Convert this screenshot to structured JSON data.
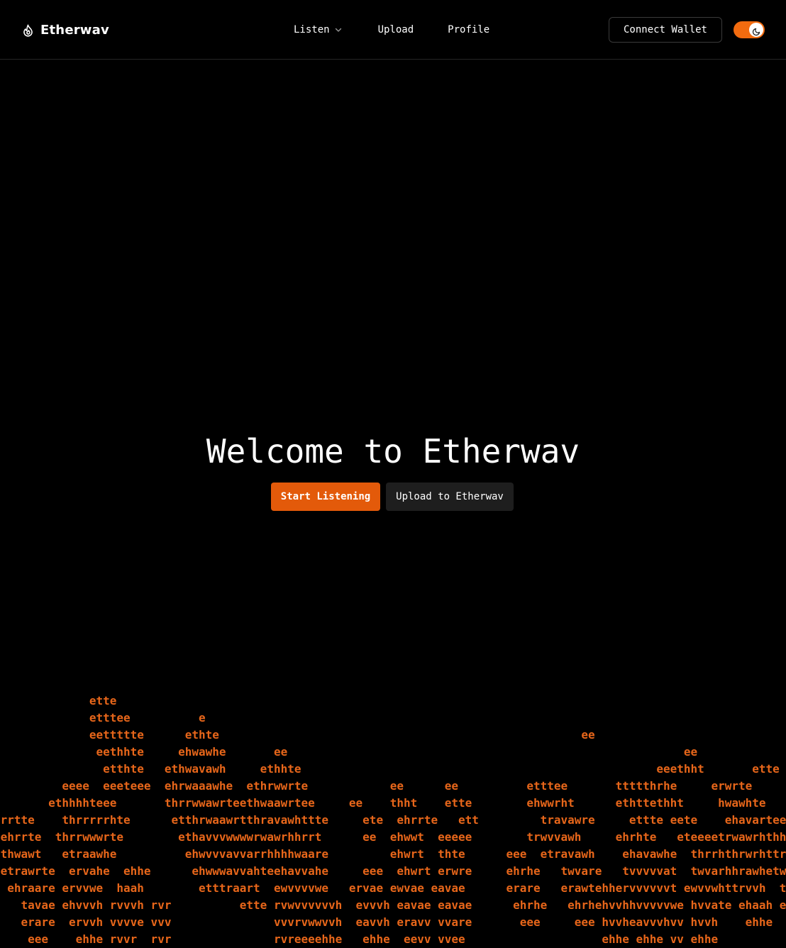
{
  "header": {
    "brand": {
      "name": "Etherwav",
      "icon": "flame-icon"
    },
    "nav": {
      "listen_label": "Listen",
      "listen_icon": "chevron-down-icon",
      "upload_label": "Upload",
      "profile_label": "Profile"
    },
    "connect_wallet_label": "Connect Wallet",
    "theme_toggle": {
      "state": "on",
      "icon": "moon-icon"
    }
  },
  "hero": {
    "title": "Welcome to Etherwav",
    "primary_button_label": "Start Listening",
    "secondary_button_label": "Upload to Etherwav"
  },
  "ascii_art": {
    "lines": [
      "              ette",
      "              etttee          e",
      "              eettttte      ethte                                                     ee",
      "               eethhte     ehwawhe       ee                                                          ee",
      "                etthte   ethwavawh     ethhte                                                    eeethht       ette",
      "          eeee  eeeteee  ehrwaaawhe  ethrwwrte            ee      ee          etttee       ttttthrhe     erwrte",
      "        ethhhhteee       thrrwwawrteethwaawrtee     ee    thht    ette        ehwwrht      ethttethht     hwawhte",
      " rrtte    thrrrrrhte      etthrwaawrtthravawhttte     ete  ehrrte   ett         travawre     ettte eete    ehavarteeeee",
      " ehrrte  thrrwwwrte        ethavvvwwwwrwawrhhrrt      ee  ehwwt  eeeee        trwvvawh     ehrhte   eteeeetrwawrhthhtt",
      " thwawt   etraawhe          ehwvvvavvarrhhhhwaare         ehwrt  thte      eee  etravawh    ehavawhe  thrrhthrwrhttrwwht",
      " etrawrte  ervahe  ehhe      ehwwwavvahteehavvahe     eee  ehwrt erwre     ehrhe   twvare   tvvvvvat  twvarhhrawhetwvahe",
      "  ehraare ervvwe  haah        etttraart  ewvvvvwe   ervae ewvae eavae      erare   erawtehhervvvvvvt ewvvwhttrvvh  twvat",
      "    tavae ehvvvh rvvvh rvr          ette rvwvvvvvvh  evvvh eavae eavae      ehrhe   ehrhehvvhhvvvvvwe hvvate ehaah ehwvvr",
      "    erare  ervvh vvvve vvv               vvvrvwwvvh  eavvh eravv vvare       eee     eee hvvheavvvhvv hvvh    ehhe  eevvv",
      "     eee    ehhe rvvr  rvr               rvreeeehhe   ehhe  eevv vvee                    ehhe ehhe vv ehhe            rva"
    ]
  },
  "colors": {
    "background": "#000000",
    "accent": "#e35a0a",
    "ascii": "#e7661a",
    "toggle": "#f26b0f",
    "secondary_button": "#1e1e1e"
  }
}
